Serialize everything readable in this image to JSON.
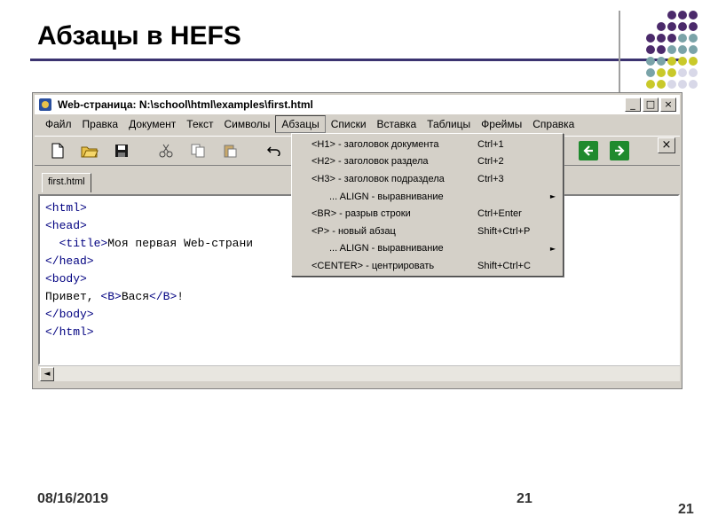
{
  "slide": {
    "title": "Абзацы в HEFS",
    "footer_date": "08/16/2019",
    "footer_page": "21",
    "corner_page": "21",
    "dot_colors": [
      "#4b2a6b",
      "#7aa3a8",
      "#c9c92a",
      "#d8d8e8"
    ]
  },
  "window": {
    "title": "Web-страница: N:\\school\\html\\examples\\first.html",
    "buttons": {
      "minimize": "_",
      "maximize": "□",
      "close": "×"
    },
    "menu": [
      "Файл",
      "Правка",
      "Документ",
      "Текст",
      "Символы",
      "Абзацы",
      "Списки",
      "Вставка",
      "Таблицы",
      "Фреймы",
      "Справка"
    ],
    "active_menu": "Абзацы",
    "toolbar": {
      "icons": [
        "new-file-icon",
        "open-folder-icon",
        "save-icon",
        "cut-icon",
        "copy-icon",
        "paste-icon",
        "undo-icon"
      ],
      "nav_icons": [
        "back-arrow-icon",
        "forward-arrow-icon"
      ],
      "close_glyph": "×"
    },
    "doc_tab": "first.html",
    "code_lines": [
      "<html>",
      "<head>",
      "  <title>Моя первая Web-страни",
      "</head>",
      "<body>",
      "Привет, <B>Вася</B>!",
      "</body>",
      "</html>"
    ],
    "scroll_left_glyph": "◄"
  },
  "dropdown": {
    "items": [
      {
        "label": "<H1> - заголовок документа",
        "shortcut": "Ctrl+1",
        "submenu": false,
        "indent": false
      },
      {
        "label": "<H2> - заголовок раздела",
        "shortcut": "Ctrl+2",
        "submenu": false,
        "indent": false
      },
      {
        "label": "<H3> - заголовок подраздела",
        "shortcut": "Ctrl+3",
        "submenu": false,
        "indent": false
      },
      {
        "label": "... ALIGN - выравнивание",
        "shortcut": "",
        "submenu": true,
        "indent": true
      },
      {
        "label": "<BR> - разрыв строки",
        "shortcut": "Ctrl+Enter",
        "submenu": false,
        "indent": false
      },
      {
        "label": "<P> - новый абзац",
        "shortcut": "Shift+Ctrl+P",
        "submenu": false,
        "indent": false
      },
      {
        "label": "... ALIGN - выравнивание",
        "shortcut": "",
        "submenu": true,
        "indent": true
      },
      {
        "label": "<CENTER> - центрировать",
        "shortcut": "Shift+Ctrl+C",
        "submenu": false,
        "indent": false
      }
    ],
    "submenu_glyph": "►"
  }
}
